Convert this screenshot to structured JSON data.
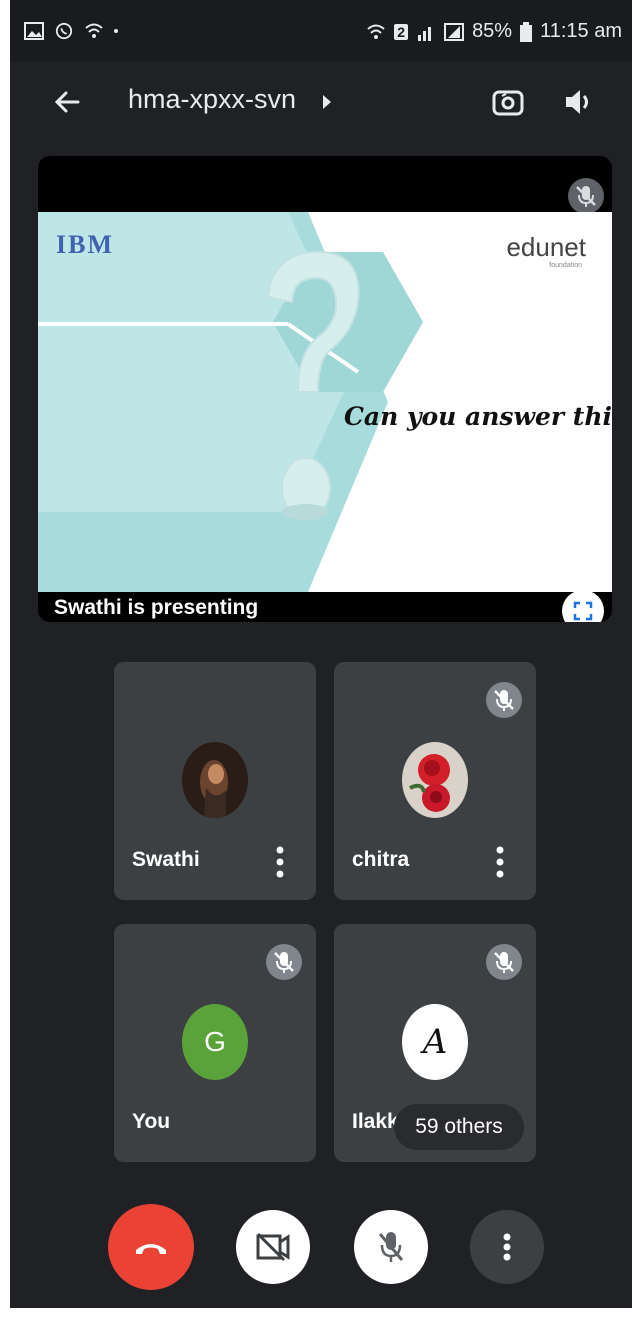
{
  "status_bar": {
    "battery": "85%",
    "time": "11:15 am",
    "sim_badge": "2"
  },
  "header": {
    "meeting_code": "hma-xpxx-svn",
    "icons": [
      "back-arrow-icon",
      "chevron-right-icon",
      "camera-switch-icon",
      "speaker-icon"
    ]
  },
  "presentation": {
    "label": "Swathi is presenting",
    "slide": {
      "ibm_logo": "IBM",
      "edunet_logo": "edunet",
      "edunet_sub": "foundation",
      "question": "Can you answer this?"
    }
  },
  "participants": [
    {
      "name": "Swathi",
      "avatar": "photo",
      "muted": false
    },
    {
      "name": "chitra",
      "avatar": "rose-photo",
      "muted": true
    },
    {
      "name": "You",
      "avatar_letter": "G",
      "avatar_color": "#5aa23a",
      "muted": true
    },
    {
      "name": "Ilakk",
      "avatar_letter": "A",
      "avatar_color": "#ffffff",
      "muted": true
    }
  ],
  "others_pill": "59 others",
  "controls": {
    "end_call_color": "#ea4335",
    "icons": [
      "end-call-icon",
      "camera-off-icon",
      "mic-off-icon",
      "more-options-icon"
    ]
  },
  "colors": {
    "background": "#202124",
    "tile": "#3c4043",
    "slide_teal": "#a8dcdc"
  }
}
